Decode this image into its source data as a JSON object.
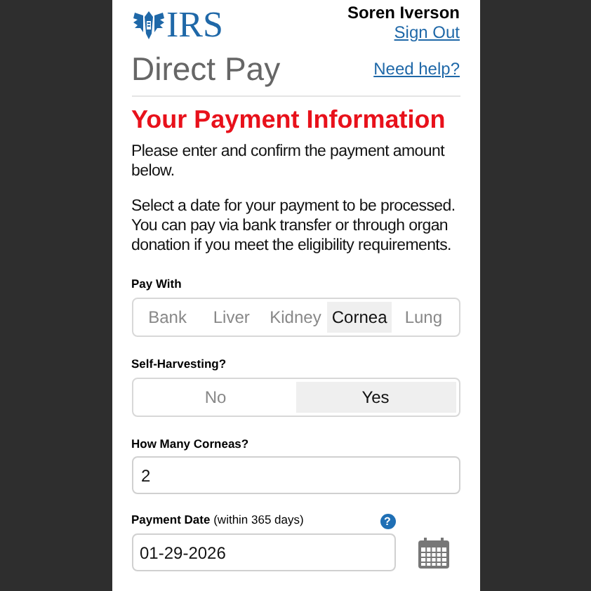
{
  "header": {
    "logo_text": "IRS",
    "user_name": "Soren Iverson",
    "sign_out": "Sign Out"
  },
  "title": "Direct Pay",
  "help_link": "Need help?",
  "section_title": "Your Payment Information",
  "paragraphs": [
    "Please enter and confirm the payment amount below.",
    "Select a date for your payment to be processed. You can pay via bank transfer or through organ donation if you meet the eligibility requirements."
  ],
  "pay_with": {
    "label": "Pay With",
    "options": [
      {
        "label": "Bank",
        "selected": false
      },
      {
        "label": "Liver",
        "selected": false
      },
      {
        "label": "Kidney",
        "selected": false
      },
      {
        "label": "Cornea",
        "selected": true
      },
      {
        "label": "Lung",
        "selected": false
      }
    ]
  },
  "self_harvesting": {
    "label": "Self-Harvesting?",
    "options": [
      {
        "label": "No",
        "selected": false
      },
      {
        "label": "Yes",
        "selected": true
      }
    ]
  },
  "quantity": {
    "label": "How Many Corneas?",
    "value": "2"
  },
  "payment_date": {
    "label": "Payment Date",
    "hint": "(within 365 days)",
    "help_icon": "?",
    "value": "01-29-2026"
  }
}
